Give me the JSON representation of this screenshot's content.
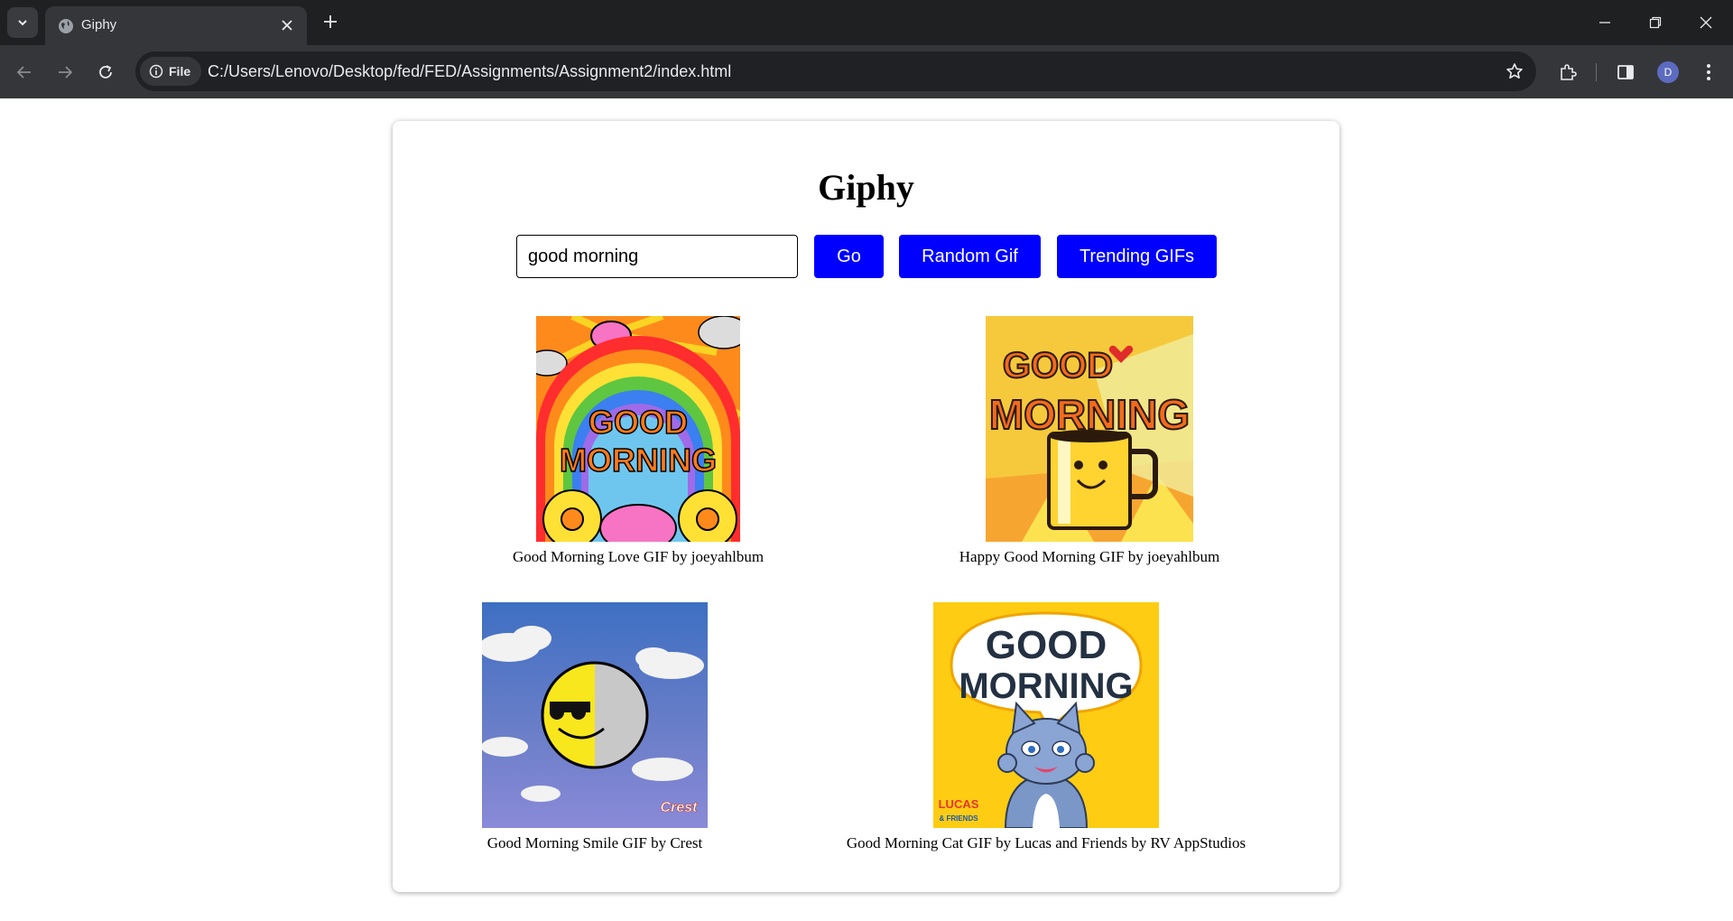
{
  "browser": {
    "tab_title": "Giphy",
    "site_chip": "File",
    "url": "C:/Users/Lenovo/Desktop/fed/FED/Assignments/Assignment2/index.html",
    "avatar_initial": "D"
  },
  "page": {
    "title": "Giphy",
    "search_value": "good morning",
    "buttons": {
      "go": "Go",
      "random": "Random Gif",
      "trending": "Trending GIFs"
    },
    "button_color": "#0000ff",
    "gifs": [
      {
        "caption": "Good Morning Love GIF by joeyahlbum",
        "image_text": [
          "GOOD",
          "MORNING"
        ]
      },
      {
        "caption": "Happy Good Morning GIF by joeyahlbum",
        "image_text": [
          "GOOD",
          "MORNING"
        ]
      },
      {
        "caption": "Good Morning Smile GIF by Crest",
        "image_text": [
          "Crest"
        ]
      },
      {
        "caption": "Good Morning Cat GIF by Lucas and Friends by RV AppStudios",
        "image_text": [
          "GOOD",
          "MORNING",
          "LUCAS",
          "& FRIENDS"
        ]
      }
    ]
  }
}
